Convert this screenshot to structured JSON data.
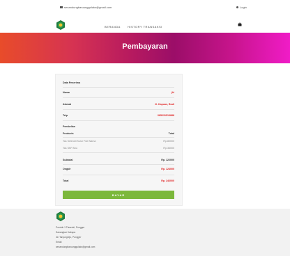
{
  "topbar": {
    "email": "senandungbaruunggulaks@gmail.com",
    "login": "Login"
  },
  "nav": {
    "beranda": "BERANDA",
    "history": "HISTORY TRANSAKSI"
  },
  "hero": {
    "title": "Pembayaran"
  },
  "colors": {
    "accent_green": "#7cb83b",
    "price_red": "#e02424"
  },
  "card": {
    "data_heading": "Data Penerima",
    "nama_label": "Nama",
    "nama_value": "jkl",
    "alamat_label": "Alamat",
    "alamat_value": "Jl. Kapuas, Bodi",
    "telp_label": "Telp",
    "telp_value": "085231513888",
    "pembelian_heading": "Pembelian",
    "products_label": "Products",
    "total_label": "Total",
    "items": [
      {
        "name": "Tas Selendri Kulur Full Warna",
        "price": "Rp.80000"
      },
      {
        "name": "Tas SKP Abu",
        "price": "Rp.36000"
      }
    ],
    "subtotal_label": "Subtotal",
    "subtotal_value": "Rp. 122000",
    "ongkir_label": "Ongkir",
    "ongkir_value": "Rp. 124000",
    "grand_label": "Total",
    "grand_value": "Rp. 246000",
    "button_label": "BAYAR"
  },
  "footer": {
    "line1": "Pondok 1 Tlaseoki, Pungger",
    "line2": "Sanangkar Kabupa",
    "line3": "Jln Tanjungrejo, Pungger",
    "line4": "Email:",
    "line5": "senandungbaruunggulaks@gmail.com"
  }
}
